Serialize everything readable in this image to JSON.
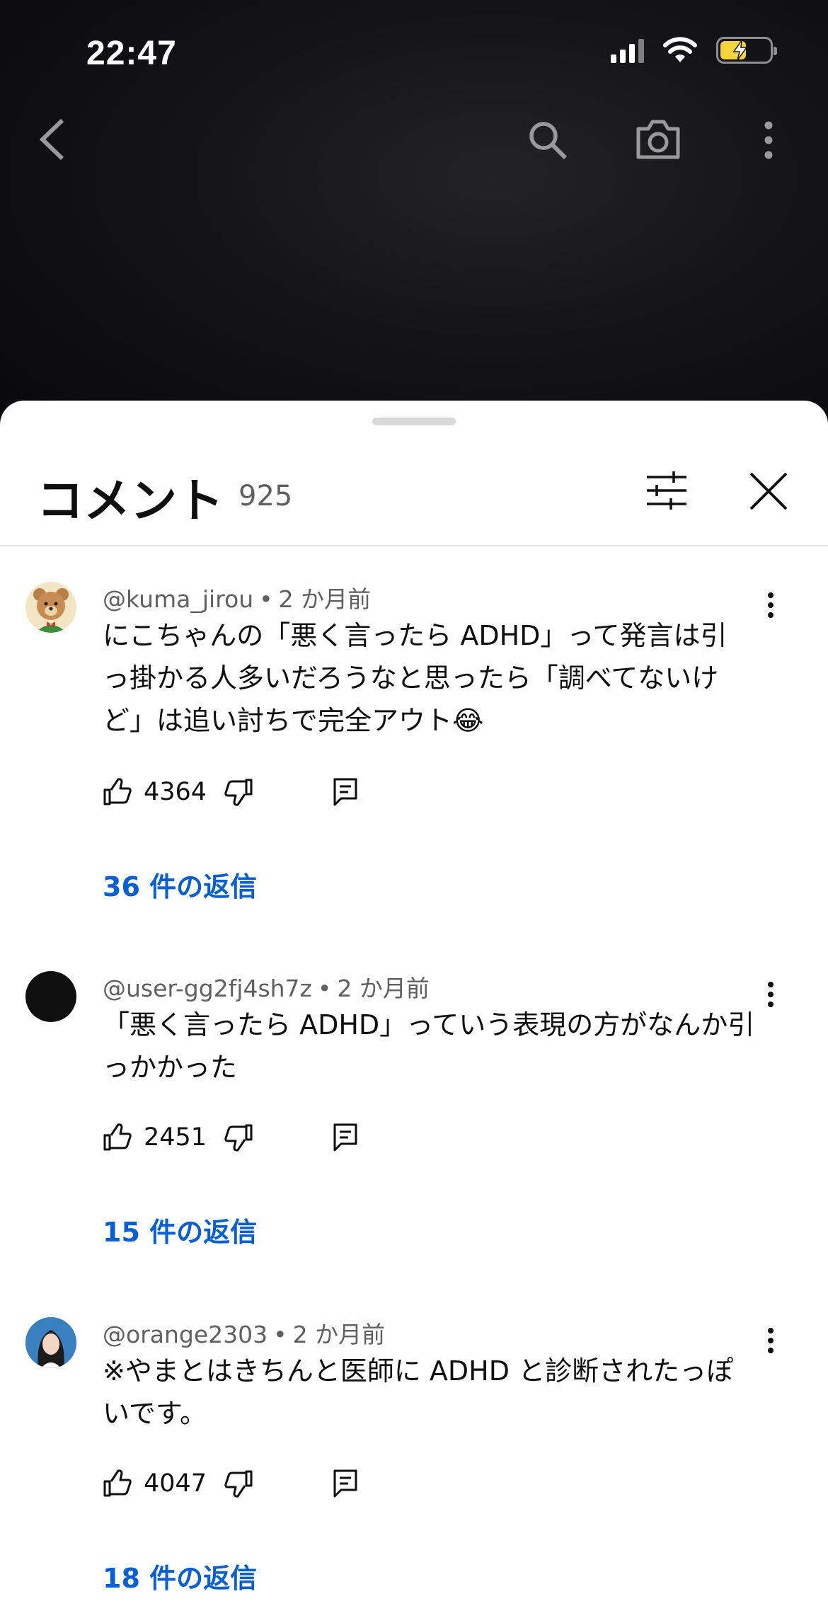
{
  "status_bar": {
    "time": "22:47"
  },
  "sheet": {
    "title": "コメント",
    "count": "925"
  },
  "comments": [
    {
      "author": "@kuma_jirou",
      "time": "2 か月前",
      "lines": [
        "にこちゃんの「悪く言ったら ADHD」って発言は引",
        "っ掛かる人多いだろうなと思ったら「調べてないけ",
        "ど」は追い討ちで完全アウト😂"
      ],
      "likes": "4364",
      "replies": "36 件の返信"
    },
    {
      "author": "@user-gg2fj4sh7z",
      "time": "2 か月前",
      "lines": [
        "「悪く言ったら ADHD」っていう表現の方がなんか引",
        "っかかった"
      ],
      "likes": "2451",
      "replies": "15 件の返信"
    },
    {
      "author": "@orange2303",
      "time": "2 か月前",
      "lines": [
        "※やまとはきちんと医師に ADHD と診断されたっぽ",
        "いです。"
      ],
      "likes": "4047",
      "replies": "18 件の返信"
    }
  ],
  "colors": {
    "link": "#065fd4",
    "meta": "#606060",
    "battery": "#f5d33b"
  }
}
